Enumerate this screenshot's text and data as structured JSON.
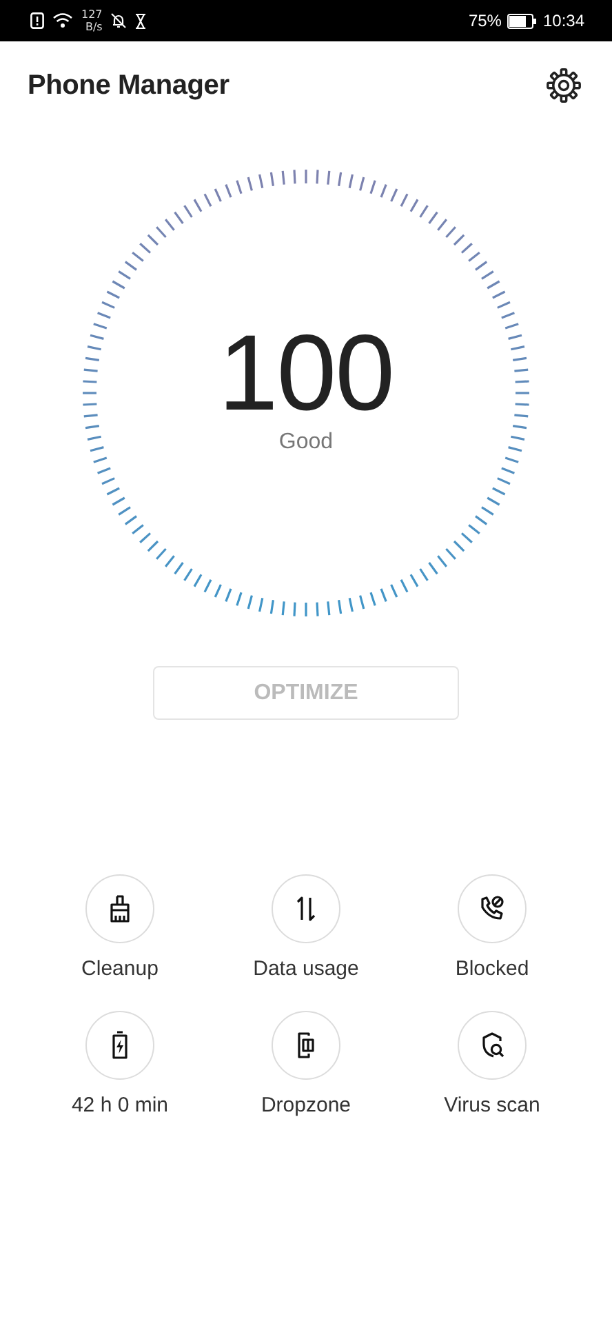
{
  "status_bar": {
    "speed_value": "127",
    "speed_unit": "B/s",
    "battery_percent": "75%",
    "time": "10:34"
  },
  "header": {
    "title": "Phone Manager"
  },
  "score": {
    "value": "100",
    "label": "Good"
  },
  "optimize_button": {
    "label": "OPTIMIZE",
    "disabled": true
  },
  "tools": [
    {
      "kind": "cleanup",
      "label": "Cleanup"
    },
    {
      "kind": "data",
      "label": "Data usage"
    },
    {
      "kind": "blocked",
      "label": "Blocked"
    },
    {
      "kind": "battery",
      "label": "42 h 0 min"
    },
    {
      "kind": "dropzone",
      "label": "Dropzone"
    },
    {
      "kind": "virus",
      "label": "Virus scan"
    }
  ]
}
